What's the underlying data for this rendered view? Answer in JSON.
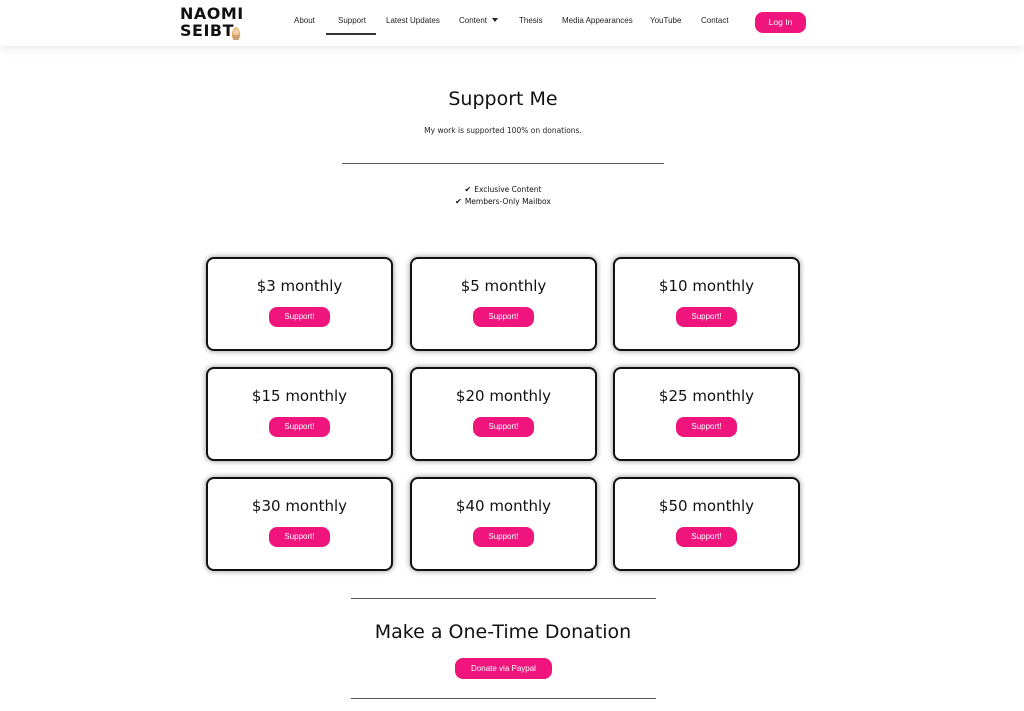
{
  "brand": {
    "logo_line1": "NAOMI",
    "logo_line2": "SEIBT",
    "accent_color": "#f0157c"
  },
  "nav": {
    "items": [
      {
        "label": "About"
      },
      {
        "label": "Support",
        "active": true
      },
      {
        "label": "Latest Updates"
      },
      {
        "label": "Content",
        "dropdown": true
      },
      {
        "label": "Thesis"
      },
      {
        "label": "Media Appearances"
      },
      {
        "label": "YouTube"
      },
      {
        "label": "Contact"
      }
    ],
    "login_label": "Log In"
  },
  "hero": {
    "title": "Support Me",
    "subtitle": "My work is supported 100% on donations.",
    "benefits": [
      "Exclusive Content",
      "Members-Only Mailbox"
    ],
    "check_icon": "checkmark-icon"
  },
  "tiers": [
    {
      "amount": "$3 monthly",
      "button": "Support!"
    },
    {
      "amount": "$5 monthly",
      "button": "Support!"
    },
    {
      "amount": "$10 monthly",
      "button": "Support!"
    },
    {
      "amount": "$15 monthly",
      "button": "Support!"
    },
    {
      "amount": "$20 monthly",
      "button": "Support!"
    },
    {
      "amount": "$25 monthly",
      "button": "Support!"
    },
    {
      "amount": "$30 monthly",
      "button": "Support!"
    },
    {
      "amount": "$40 monthly",
      "button": "Support!"
    },
    {
      "amount": "$50 monthly",
      "button": "Support!"
    }
  ],
  "one_time": {
    "title": "Make a One-Time Donation",
    "button": "Donate via Paypal"
  }
}
